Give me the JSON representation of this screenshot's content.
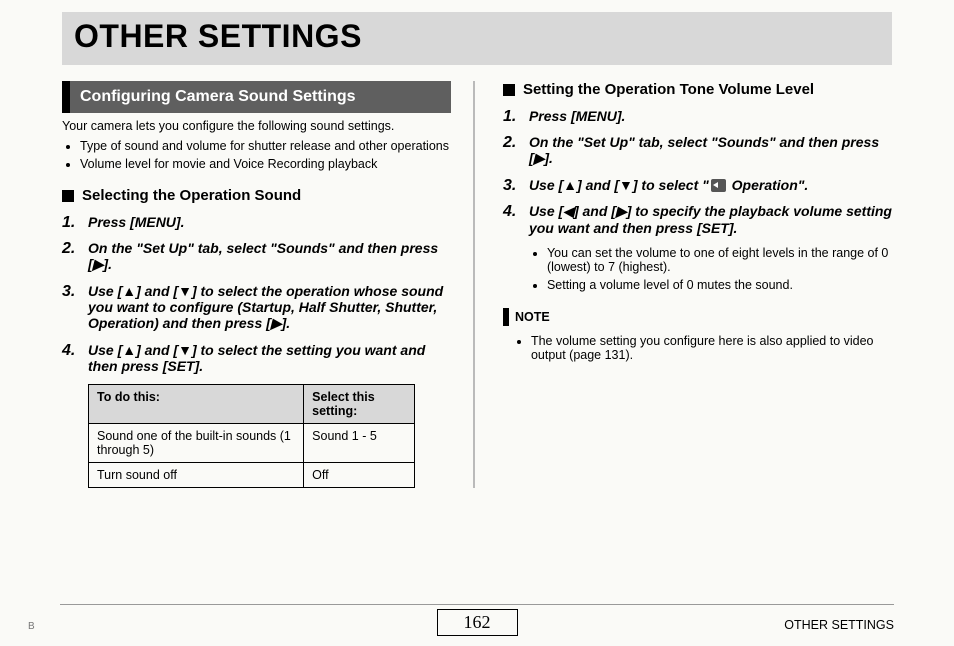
{
  "title": "OTHER SETTINGS",
  "left": {
    "section": "Configuring Camera Sound Settings",
    "intro": "Your camera lets you configure the following sound settings.",
    "intro_bullets": [
      "Type of sound and volume for shutter release and other operations",
      "Volume level for movie and Voice Recording playback"
    ],
    "sub": "Selecting the Operation Sound",
    "steps": [
      "Press [MENU].",
      "On the \"Set Up\" tab, select \"Sounds\" and then press [▶].",
      "Use [▲] and [▼] to select the operation whose sound you want to configure (Startup, Half Shutter, Shutter, Operation) and then press [▶].",
      "Use [▲] and [▼] to select the setting you want and then press [SET]."
    ],
    "table": {
      "head_a": "To do this:",
      "head_b": "Select this setting:",
      "rows": [
        {
          "a": "Sound one of the built-in sounds (1 through 5)",
          "b": "Sound 1 - 5"
        },
        {
          "a": "Turn sound off",
          "b": "Off"
        }
      ]
    }
  },
  "right": {
    "sub": "Setting the Operation Tone Volume Level",
    "steps": [
      "Press [MENU].",
      "On the \"Set Up\" tab, select \"Sounds\" and then press [▶].",
      "Use [▲] and [▼] to select \" 🔊 Operation\".",
      "Use [◀] and [▶] to specify the playback volume setting you want and then press [SET]."
    ],
    "sub_bullets": [
      "You can set the volume to one of eight levels in the range of 0 (lowest) to 7 (highest).",
      "Setting a volume level of 0 mutes the sound."
    ],
    "note_label": "NOTE",
    "note_bullets": [
      "The volume setting you configure here is also applied to video output (page 131)."
    ]
  },
  "footer": {
    "page": "162",
    "right": "OTHER SETTINGS",
    "left": "B"
  }
}
